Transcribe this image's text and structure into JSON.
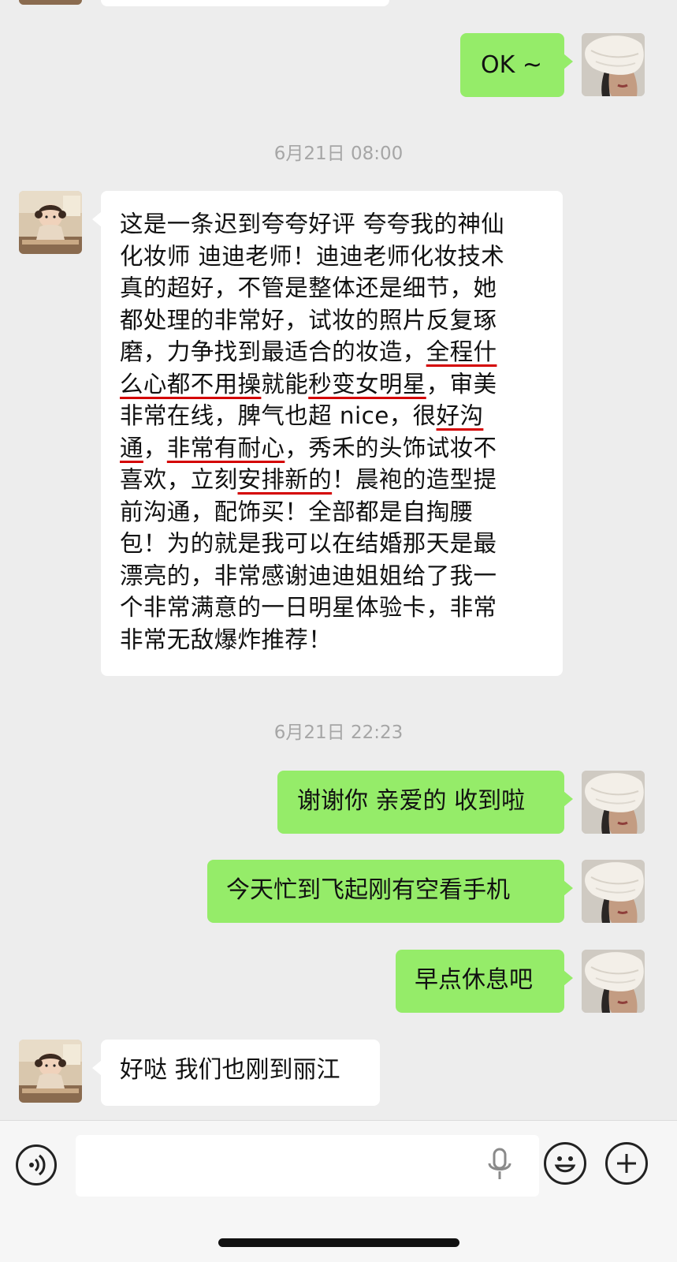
{
  "chat": {
    "messages": [
      {
        "side": "right",
        "text": "OK ~"
      },
      {
        "type": "timestamp",
        "text": "6月21日 08:00"
      },
      {
        "side": "left",
        "lines": [
          [
            {
              "t": "这是一条迟到夸夸好评 夸夸我的神仙"
            }
          ],
          [
            {
              "t": "化妆师 迪迪老师！迪迪老师化妆技术"
            }
          ],
          [
            {
              "t": "真的超好，不管是整体还是细节，她"
            }
          ],
          [
            {
              "t": "都处理的非常好，试妆的照片反复琢"
            }
          ],
          [
            {
              "t": "磨，力争找到最适合的妆造，"
            },
            {
              "t": "全程什",
              "u": true
            }
          ],
          [
            {
              "t": "么心都不用操",
              "u": true
            },
            {
              "t": "就能"
            },
            {
              "t": "秒变女明星",
              "u": true
            },
            {
              "t": "，审美"
            }
          ],
          [
            {
              "t": "非常在线，脾气也超 nice，很"
            },
            {
              "t": "好沟",
              "u": true
            }
          ],
          [
            {
              "t": "通",
              "u": true
            },
            {
              "t": "，"
            },
            {
              "t": "非常有耐心",
              "u": true
            },
            {
              "t": "，秀禾的头饰试妆不"
            }
          ],
          [
            {
              "t": "喜欢，立刻"
            },
            {
              "t": "安排新的",
              "u": true
            },
            {
              "t": "！晨袍的造型提"
            }
          ],
          [
            {
              "t": "前沟通，配饰买！全部都是自掏腰"
            }
          ],
          [
            {
              "t": "包！为的就是我可以在结婚那天是最"
            }
          ],
          [
            {
              "t": "漂亮的，非常感谢迪迪姐姐给了我一"
            }
          ],
          [
            {
              "t": "个非常满意的一日明星体验卡，非常"
            }
          ],
          [
            {
              "t": "非常无敌爆炸推荐！"
            }
          ]
        ]
      },
      {
        "type": "timestamp",
        "text": "6月21日 22:23"
      },
      {
        "side": "right",
        "text": "谢谢你 亲爱的 收到啦"
      },
      {
        "side": "right",
        "text": "今天忙到飞起刚有空看手机"
      },
      {
        "side": "right",
        "text": "早点休息吧"
      },
      {
        "side": "left",
        "text": "好哒 我们也刚到丽江"
      }
    ]
  },
  "input_bar": {
    "message_value": "",
    "voice_icon": "voice-wave-icon",
    "mic_icon": "microphone-icon",
    "emoji_icon": "smiley-face-icon",
    "more_icon": "plus-icon"
  },
  "colors": {
    "chat_background": "#ededed",
    "sent_bubble": "#95ec69",
    "received_bubble": "#ffffff",
    "timestamp_text": "#a6a6a6",
    "underline_annotation": "#d40000"
  }
}
